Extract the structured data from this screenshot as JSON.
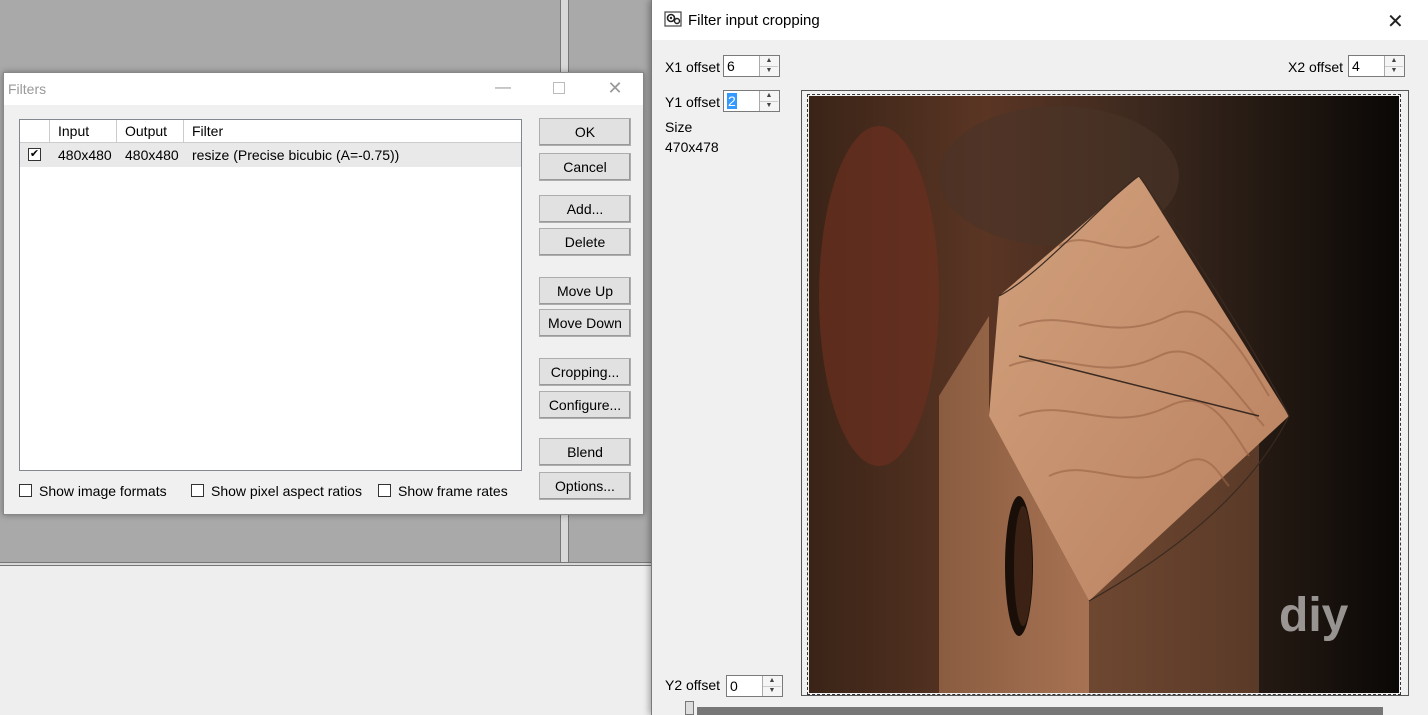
{
  "filters_dialog": {
    "title": "Filters",
    "columns": [
      "Input",
      "Output",
      "Filter"
    ],
    "rows": [
      {
        "checked": true,
        "input": "480x480",
        "output": "480x480",
        "filter": "resize (Precise bicubic (A=-0.75))"
      }
    ],
    "buttons": {
      "ok": "OK",
      "cancel": "Cancel",
      "add": "Add...",
      "delete": "Delete",
      "move_up": "Move Up",
      "move_down": "Move Down",
      "cropping": "Cropping...",
      "configure": "Configure...",
      "blend": "Blend",
      "options": "Options..."
    },
    "options": {
      "show_image_formats": "Show image formats",
      "show_pixel_aspect_ratios": "Show pixel aspect ratios",
      "show_frame_rates": "Show frame rates"
    }
  },
  "crop_dialog": {
    "title": "Filter input cropping",
    "x1_label": "X1 offset",
    "x1_value": "6",
    "y1_label": "Y1 offset",
    "y1_value": "2",
    "x2_label": "X2 offset",
    "x2_value": "4",
    "y2_label": "Y2 offset",
    "y2_value": "0",
    "size_label": "Size",
    "size_value": "470x478",
    "watermark": "diy"
  }
}
